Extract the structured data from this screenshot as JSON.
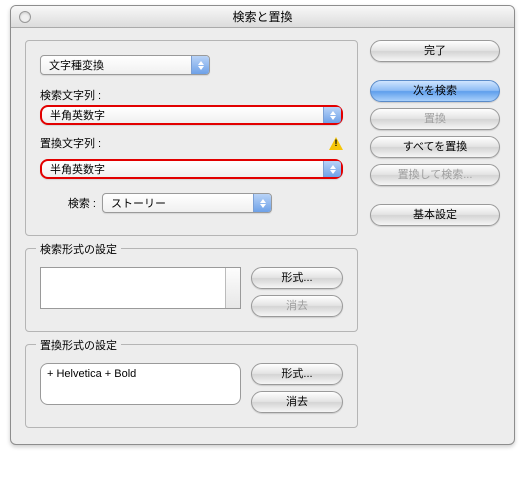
{
  "window": {
    "title": "検索と置換"
  },
  "panel": {
    "type_select": "文字種変換",
    "search_label": "検索文字列 :",
    "search_value": "半角英数字",
    "replace_label": "置換文字列 :",
    "replace_value": "半角英数字",
    "scope_label": "検索 :",
    "scope_value": "ストーリー"
  },
  "buttons": {
    "done": "完了",
    "find_next": "次を検索",
    "change": "置換",
    "change_all": "すべてを置換",
    "change_find": "置換して検索...",
    "prefs": "基本設定"
  },
  "find_format": {
    "legend": "検索形式の設定",
    "value": "",
    "format_btn": "形式...",
    "clear_btn": "消去"
  },
  "replace_format": {
    "legend": "置換形式の設定",
    "value": "+ Helvetica + Bold",
    "format_btn": "形式...",
    "clear_btn": "消去"
  }
}
